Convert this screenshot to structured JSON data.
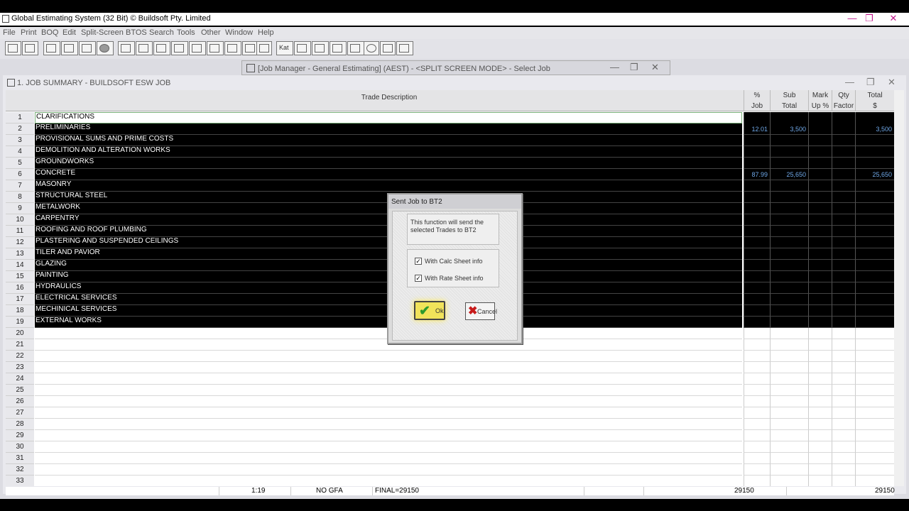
{
  "app": {
    "title": "Global Estimating System (32 Bit) © Buildsoft Pty. Limited"
  },
  "menu": [
    "File",
    "Print",
    "BOQ",
    "Edit",
    "Split-Screen",
    "BTOS",
    "Search",
    "Tools",
    "Other",
    "Window",
    "Help"
  ],
  "toolbar": {
    "icons": [
      "copy-job-icon",
      "paste-job-icon",
      "calc-icon",
      "rates-icon",
      "eraser-icon",
      "circle-icon",
      "trade-icon",
      "items-icon",
      "sheets-icon",
      "pages-icon",
      "list-icon",
      "ruler-icon",
      "scale-icon",
      "tree-icon",
      "bin-icon",
      "kat-icon",
      "grid-icon",
      "chart-icon",
      "graph-icon",
      "split-icon",
      "gear-icon",
      "settings-icon",
      "pen-icon"
    ],
    "kat_label": "Kat"
  },
  "job_manager": {
    "title": "[Job Manager - General Estimating] (AEST) - <SPLIT SCREEN MODE> - Select Job"
  },
  "job_window": {
    "title": "1. JOB SUMMARY - BUILDSOFT ESW JOB"
  },
  "columns": {
    "trade": "Trade Description",
    "pct": [
      "%",
      "Job"
    ],
    "sub": [
      "Sub",
      "Total"
    ],
    "mark": [
      "Mark",
      "Up %"
    ],
    "qty": [
      "Qty",
      "Factor"
    ],
    "total": [
      "Total",
      "$"
    ]
  },
  "rows": [
    {
      "n": "1",
      "desc": "CLARIFICATIONS",
      "pct": "",
      "sub": "",
      "total": ""
    },
    {
      "n": "2",
      "desc": "PRELIMINARIES",
      "pct": "12.01",
      "sub": "3,500",
      "total": "3,500"
    },
    {
      "n": "3",
      "desc": "PROVISIONAL SUMS AND PRIME COSTS",
      "pct": "",
      "sub": "",
      "total": ""
    },
    {
      "n": "4",
      "desc": "DEMOLITION AND ALTERATION WORKS",
      "pct": "",
      "sub": "",
      "total": ""
    },
    {
      "n": "5",
      "desc": "GROUNDWORKS",
      "pct": "",
      "sub": "",
      "total": ""
    },
    {
      "n": "6",
      "desc": "CONCRETE",
      "pct": "87.99",
      "sub": "25,650",
      "total": "25,650"
    },
    {
      "n": "7",
      "desc": "MASONRY",
      "pct": "",
      "sub": "",
      "total": ""
    },
    {
      "n": "8",
      "desc": "STRUCTURAL STEEL",
      "pct": "",
      "sub": "",
      "total": ""
    },
    {
      "n": "9",
      "desc": "METALWORK",
      "pct": "",
      "sub": "",
      "total": ""
    },
    {
      "n": "10",
      "desc": "CARPENTRY",
      "pct": "",
      "sub": "",
      "total": ""
    },
    {
      "n": "11",
      "desc": "ROOFING AND ROOF PLUMBING",
      "pct": "",
      "sub": "",
      "total": ""
    },
    {
      "n": "12",
      "desc": "PLASTERING AND SUSPENDED CEILINGS",
      "pct": "",
      "sub": "",
      "total": ""
    },
    {
      "n": "13",
      "desc": "TILER AND PAVIOR",
      "pct": "",
      "sub": "",
      "total": ""
    },
    {
      "n": "14",
      "desc": "GLAZING",
      "pct": "",
      "sub": "",
      "total": ""
    },
    {
      "n": "15",
      "desc": "PAINTING",
      "pct": "",
      "sub": "",
      "total": ""
    },
    {
      "n": "16",
      "desc": "HYDRAULICS",
      "pct": "",
      "sub": "",
      "total": ""
    },
    {
      "n": "17",
      "desc": "ELECTRICAL SERVICES",
      "pct": "",
      "sub": "",
      "total": ""
    },
    {
      "n": "18",
      "desc": "MECHINICAL SERVICES",
      "pct": "",
      "sub": "",
      "total": ""
    },
    {
      "n": "19",
      "desc": "EXTERNAL WORKS",
      "pct": "",
      "sub": "",
      "total": ""
    },
    {
      "n": "20",
      "desc": "",
      "pct": "",
      "sub": "",
      "total": ""
    },
    {
      "n": "21",
      "desc": "",
      "pct": "",
      "sub": "",
      "total": ""
    },
    {
      "n": "22",
      "desc": "",
      "pct": "",
      "sub": "",
      "total": ""
    },
    {
      "n": "23",
      "desc": "",
      "pct": "",
      "sub": "",
      "total": ""
    },
    {
      "n": "24",
      "desc": "",
      "pct": "",
      "sub": "",
      "total": ""
    },
    {
      "n": "25",
      "desc": "",
      "pct": "",
      "sub": "",
      "total": ""
    },
    {
      "n": "26",
      "desc": "",
      "pct": "",
      "sub": "",
      "total": ""
    },
    {
      "n": "27",
      "desc": "",
      "pct": "",
      "sub": "",
      "total": ""
    },
    {
      "n": "28",
      "desc": "",
      "pct": "",
      "sub": "",
      "total": ""
    },
    {
      "n": "29",
      "desc": "",
      "pct": "",
      "sub": "",
      "total": ""
    },
    {
      "n": "30",
      "desc": "",
      "pct": "",
      "sub": "",
      "total": ""
    },
    {
      "n": "31",
      "desc": "",
      "pct": "",
      "sub": "",
      "total": ""
    },
    {
      "n": "32",
      "desc": "",
      "pct": "",
      "sub": "",
      "total": ""
    },
    {
      "n": "33",
      "desc": "",
      "pct": "",
      "sub": "",
      "total": ""
    }
  ],
  "status": {
    "position": "1:19",
    "gfa": "NO GFA",
    "final": "FINAL=29150",
    "subtotal": "29150",
    "total": "29150"
  },
  "dialog": {
    "title": "Sent Job to BT2",
    "message": "This function will send the selected Trades to BT2",
    "opt_calc": "With Calc Sheet info",
    "opt_rate": "With Rate Sheet info",
    "opt_calc_checked": true,
    "opt_rate_checked": true,
    "ok_label": "Ok",
    "cancel_label": "Cancel"
  },
  "colors": {
    "selected_band": "#000000",
    "value_text": "#6fa8e8",
    "ok_highlight": "#f1e35a"
  }
}
